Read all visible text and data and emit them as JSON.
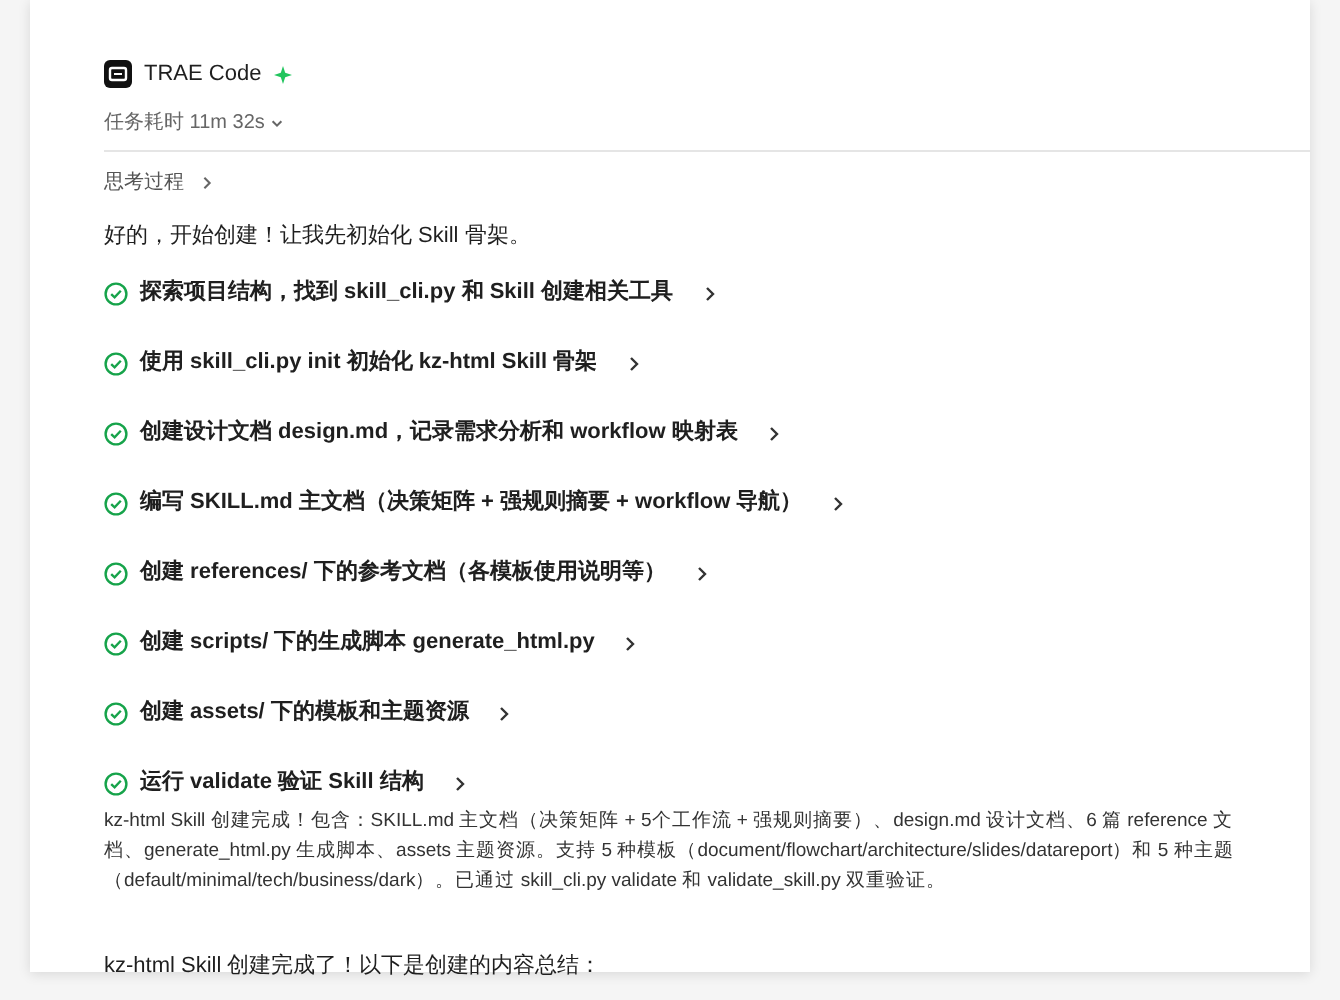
{
  "header": {
    "title": "TRAE Code"
  },
  "duration": {
    "label": "任务耗时 11m 32s"
  },
  "thinking": {
    "label": "思考过程"
  },
  "intro": "好的，开始创建！让我先初始化 Skill 骨架。",
  "steps": [
    {
      "label": "探索项目结构，找到 skill_cli.py 和 Skill 创建相关工具",
      "completed": true
    },
    {
      "label": "使用 skill_cli.py init 初始化 kz-html Skill 骨架",
      "completed": true
    },
    {
      "label": "创建设计文档 design.md，记录需求分析和 workflow 映射表",
      "completed": true
    },
    {
      "label": "编写 SKILL.md 主文档（决策矩阵 + 强规则摘要 + workflow 导航）",
      "completed": true
    },
    {
      "label": "创建 references/ 下的参考文档（各模板使用说明等）",
      "completed": true
    },
    {
      "label": "创建 scripts/ 下的生成脚本 generate_html.py",
      "completed": true
    },
    {
      "label": "创建 assets/ 下的模板和主题资源",
      "completed": true
    },
    {
      "label": "运行 validate 验证 Skill 结构",
      "completed": true
    }
  ],
  "result": "kz-html Skill 创建完成！包含：SKILL.md 主文档（决策矩阵 + 5个工作流 + 强规则摘要）、design.md 设计文档、6 篇 reference 文档、generate_html.py 生成脚本、assets 主题资源。支持 5 种模板（document/flowchart/architecture/slides/datareport）和 5 种主题（default/minimal/tech/business/dark）。已通过 skill_cli.py validate 和 validate_skill.py 双重验证。",
  "summary": "kz-html Skill 创建完成了！以下是创建的内容总结："
}
